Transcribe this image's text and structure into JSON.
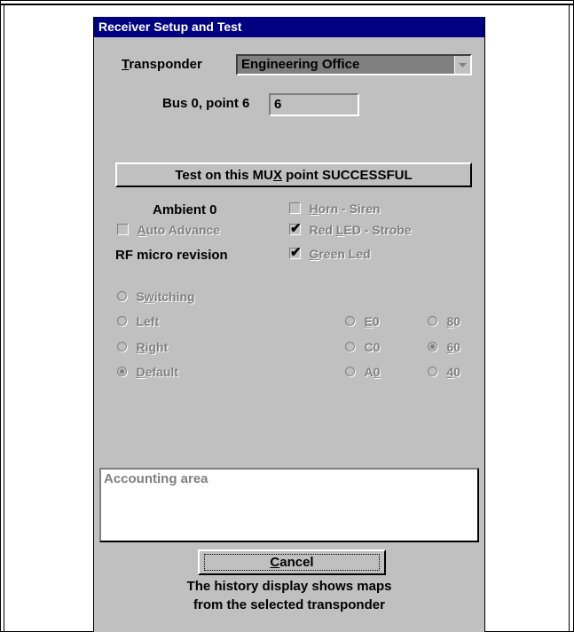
{
  "dialog": {
    "title": "Receiver Setup and Test"
  },
  "transponder": {
    "label_prefix": "",
    "label_mnemonic": "T",
    "label_rest": "ransponder",
    "selected": "Engineering Office"
  },
  "bus_point": {
    "label": "Bus 0, point 6",
    "value": "6"
  },
  "test_button": {
    "pre": "Test on this MU",
    "mnemonic": "X",
    "post": " point SUCCESSFUL"
  },
  "ambient": "Ambient 0",
  "rf_micro": "RF micro revision",
  "checkboxes": {
    "horn_siren": {
      "mnemonic": "H",
      "rest": "orn - Siren",
      "checked": false
    },
    "auto_advance": {
      "mnemonic": "A",
      "rest": "uto Advance",
      "checked": false
    },
    "red_led": {
      "pre": "Red ",
      "mnemonic": "L",
      "rest": "ED - Strobe",
      "checked": true
    },
    "green_led": {
      "mnemonic": "G",
      "rest": "reen Led",
      "checked": true
    }
  },
  "mode_radios": {
    "switching": {
      "pre": "S",
      "mnemonic": "w",
      "rest": "itching",
      "selected": false
    },
    "left": {
      "label": "Left",
      "selected": false
    },
    "right": {
      "mnemonic": "R",
      "rest": "ight",
      "selected": false
    },
    "default": {
      "mnemonic": "D",
      "rest": "efault",
      "selected": true
    }
  },
  "address_radios": {
    "e0": {
      "mnemonic": "E",
      "rest": "0",
      "selected": false
    },
    "c0": {
      "label": "C0",
      "selected": false
    },
    "a0": {
      "pre": "A",
      "mnemonic": "0",
      "rest": "",
      "selected": false
    },
    "r80": {
      "mnemonic": "8",
      "rest": "0",
      "selected": false
    },
    "r60": {
      "mnemonic": "6",
      "rest": "0",
      "selected": true
    },
    "r40": {
      "mnemonic": "4",
      "rest": "0",
      "selected": false
    }
  },
  "area_text": "Accounting area",
  "cancel_button": {
    "mnemonic": "C",
    "rest": "ancel"
  },
  "history_note": {
    "line1": "The history display shows maps",
    "line2": "from the selected transponder"
  },
  "colors": {
    "title_bar": "#000080",
    "dialog_bg": "#c0c0c0",
    "disabled_text": "#808080"
  },
  "icons": {
    "combo_arrow": "chevron-down-icon",
    "check": "check-icon"
  }
}
